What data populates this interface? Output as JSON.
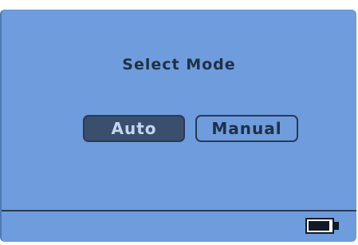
{
  "screen": {
    "title": "Select Mode",
    "modes": [
      {
        "label": "Auto",
        "selected": true
      },
      {
        "label": "Manual",
        "selected": false
      }
    ]
  },
  "status_bar": {
    "battery_icon": "battery-icon",
    "battery_level": 0.8
  },
  "colors": {
    "screen_background": "#6e9cdc",
    "selected_button": "#3a4f6d",
    "text_dark": "#1f3046"
  }
}
